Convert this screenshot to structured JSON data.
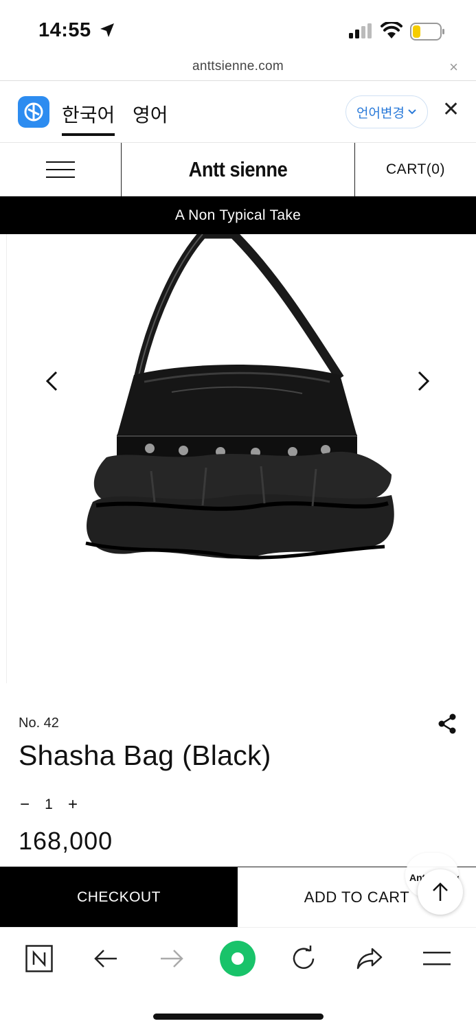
{
  "status_bar": {
    "time": "14:55"
  },
  "browser": {
    "url": "anttsienne.com",
    "close_symbol": "×"
  },
  "translate": {
    "active_lang": "한국어",
    "other_lang": "영어",
    "change_button": "언어변경",
    "close_symbol": "✕"
  },
  "site_header": {
    "brand": "Antt sienne",
    "cart": "CART(0)"
  },
  "tagline": "A Non Typical Take",
  "product": {
    "number": "No. 42",
    "title": "Shasha Bag (Black)",
    "quantity": {
      "minus": "−",
      "value": "1",
      "plus": "+"
    },
    "price": "168,000"
  },
  "actions": {
    "checkout": "CHECKOUT",
    "add_to_cart": "ADD TO CART"
  },
  "floating": {
    "brand_bubble": "Antt sienne"
  },
  "colors": {
    "accent_blue": "#2d8cf0",
    "toolbar_green": "#19c36a",
    "black": "#000000"
  }
}
